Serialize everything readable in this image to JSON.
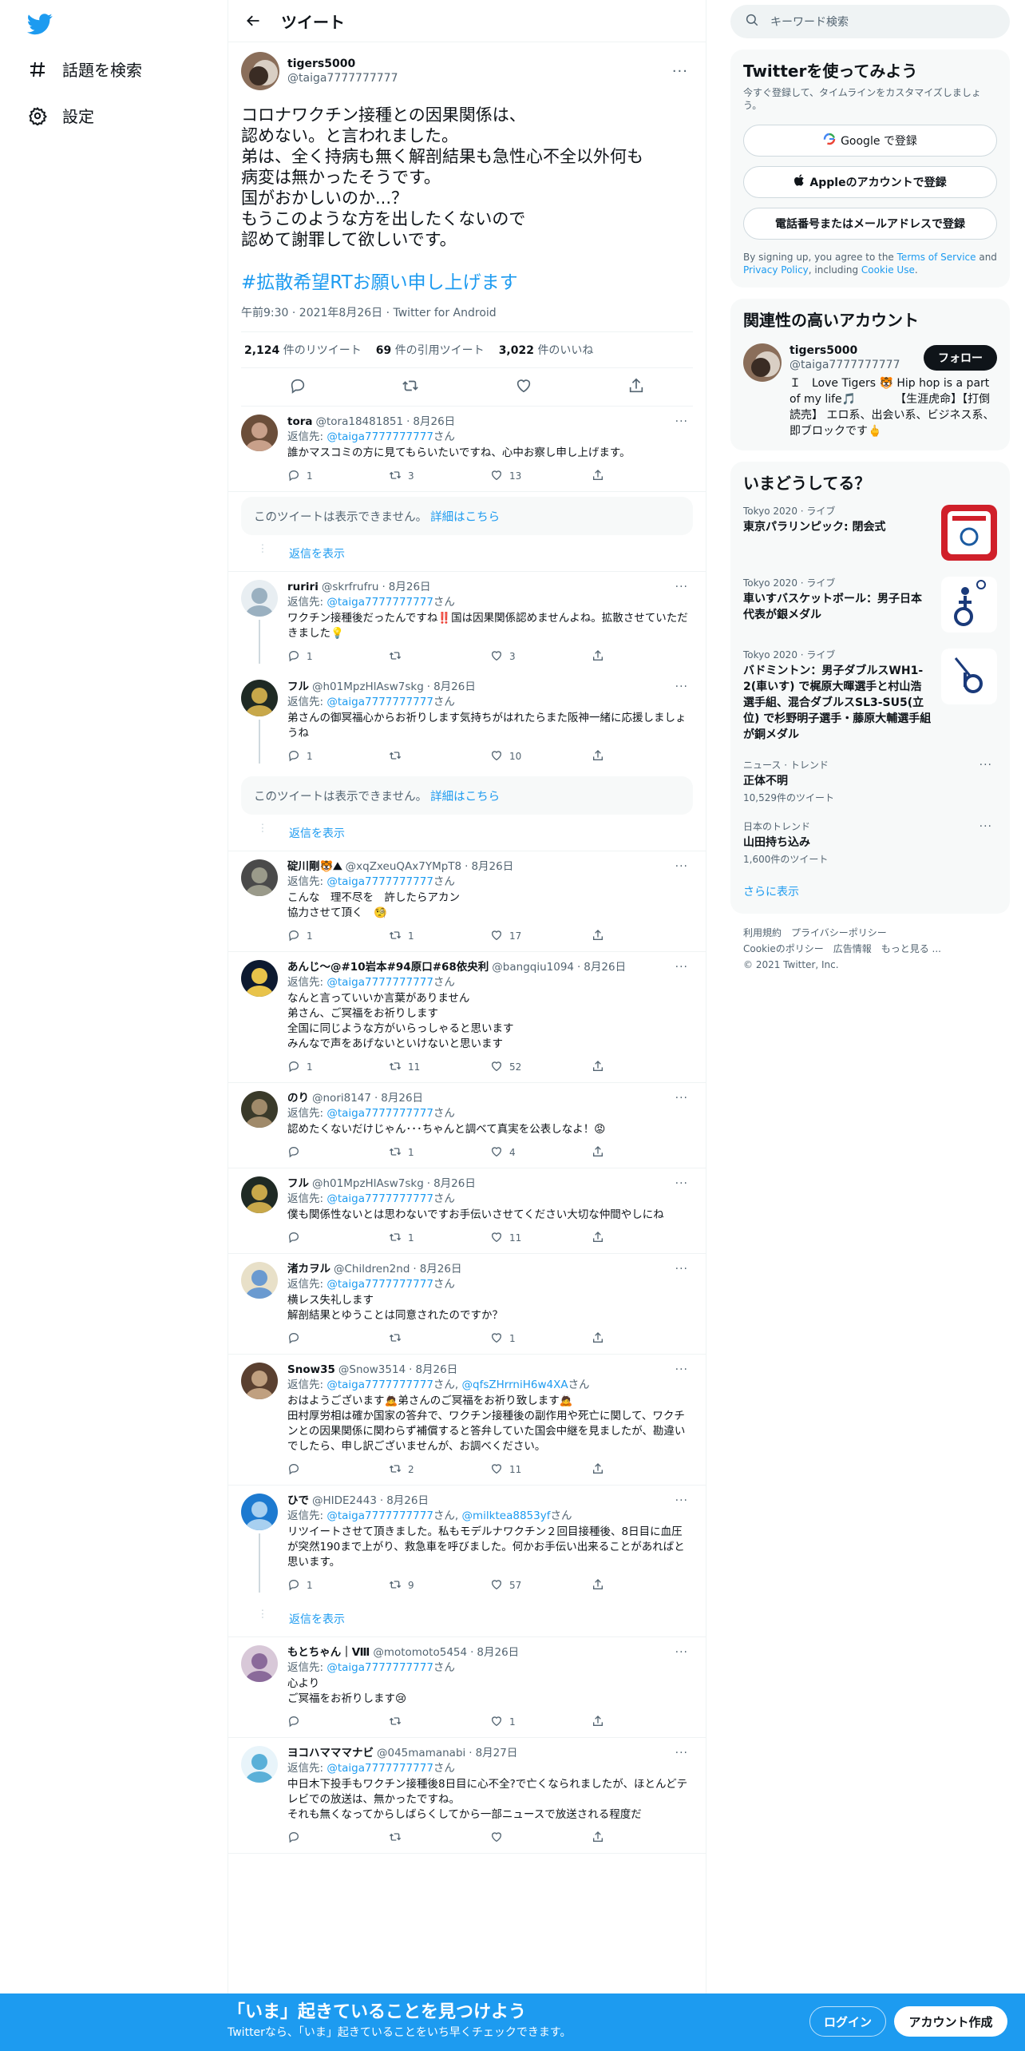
{
  "left_nav": {
    "explore_label": "話題を検索",
    "settings_label": "設定"
  },
  "header": {
    "title": "ツイート"
  },
  "focus_tweet": {
    "author_name": "tigers5000",
    "author_handle": "@taiga7777777777",
    "text": "コロナワクチン接種との因果関係は、\n認めない。と言われました。\n弟は、全く持病も無く解剖結果も急性心不全以外何も\n病変は無かったそうです。\n国がおかしいのか...？\nもうこのような方を出したくないので\n認めて謝罪して欲しいです。",
    "hashtag": "#拡散希望RTお願い申し上げます",
    "meta": "午前9:30 · 2021年8月26日 · Twitter for Android",
    "retweets": "2,124",
    "retweets_label": "件のリツイート",
    "quotes": "69",
    "quotes_label": "件の引用ツイート",
    "likes": "3,022",
    "likes_label": "件のいいね"
  },
  "reply_to_label": "返信先:",
  "san": "さん",
  "hidden_text": "このツイートは表示できません。",
  "hidden_link": "詳細はこちら",
  "show_replies": "返信を表示",
  "replies": [
    {
      "name": "tora",
      "handle": "@tora18481851",
      "date": "8月26日",
      "to": "@taiga7777777777",
      "text": "誰かマスコミの方に見てもらいたいですね、心中お察し申し上げます。",
      "reply": "1",
      "rt": "3",
      "like": "13"
    },
    {
      "name": "ruriri",
      "handle": "@skrfrufru",
      "date": "8月26日",
      "to": "@taiga7777777777",
      "text": "ワクチン接種後だったんですね‼️国は因果関係認めませんよね。拡散させていただきました💡",
      "reply": "1",
      "rt": "",
      "like": "3"
    },
    {
      "name": "フル",
      "handle": "@h01MpzHlAsw7skg",
      "date": "8月26日",
      "to": "@taiga7777777777",
      "text": "弟さんの御冥福心からお祈りします気持ちがはれたらまた阪神一緒に応援しましょうね",
      "reply": "1",
      "rt": "",
      "like": "10"
    },
    {
      "name": "碇川剛🐯⛰",
      "handle": "@xqZxeuQAx7YMpT8",
      "date": "8月26日",
      "to": "@taiga7777777777",
      "text": "こんな　理不尽を　許したらアカン\n協力させて頂く　🧐",
      "reply": "1",
      "rt": "1",
      "like": "17"
    },
    {
      "name": "あんじ〜@#10岩本#94原口#68依央利",
      "handle": "@bangqiu1094",
      "date": "8月26日",
      "to": "@taiga7777777777",
      "text": "なんと言っていいか言葉がありません\n弟さん、ご冥福をお祈りします\n全国に同じような方がいらっしゃると思います\nみんなで声をあげないといけないと思います",
      "reply": "1",
      "rt": "11",
      "like": "52"
    },
    {
      "name": "のり",
      "handle": "@nori8147",
      "date": "8月26日",
      "to": "@taiga7777777777",
      "text": "認めたくないだけじゃん･･･ちゃんと調べて真実を公表しなよ！😡",
      "reply": "",
      "rt": "1",
      "like": "4"
    },
    {
      "name": "フル",
      "handle": "@h01MpzHlAsw7skg",
      "date": "8月26日",
      "to": "@taiga7777777777",
      "text": "僕も関係性ないとは思わないですお手伝いさせてください大切な仲間やしにね",
      "reply": "",
      "rt": "1",
      "like": "11"
    },
    {
      "name": "渚カヲル",
      "handle": "@Children2nd",
      "date": "8月26日",
      "to": "@taiga7777777777",
      "text": "横レス失礼します\n解剖結果とゆうことは同意されたのですか？",
      "reply": "",
      "rt": "",
      "like": "1"
    },
    {
      "name": "Snow35",
      "handle": "@Snow3514",
      "date": "8月26日",
      "to": "@taiga7777777777",
      "to2": "@qfsZHrrniH6w4XA",
      "text": "おはようございます🙇弟さんのご冥福をお祈り致します🙇\n田村厚労相は確か国家の答弁で、ワクチン接種後の副作用や死亡に関して、ワクチンとの因果関係に関わらず補償すると答弁していた国会中継を見ましたが、勘違いでしたら、申し訳ございませんが、お調べください。",
      "reply": "",
      "rt": "2",
      "like": "11"
    },
    {
      "name": "ひで",
      "handle": "@HIDE2443",
      "date": "8月26日",
      "to": "@taiga7777777777",
      "to2": "@milktea8853yf",
      "text": "リツイートさせて頂きました。私もモデルナワクチン２回目接種後、8日目に血圧が突然190まで上がり、救急車を呼びました。何かお手伝い出来ることがあればと思います。",
      "reply": "1",
      "rt": "9",
      "like": "57"
    },
    {
      "name": "もとちゃん｜Ⅷ",
      "handle": "@motomoto5454",
      "date": "8月26日",
      "to": "@taiga7777777777",
      "text": "心より\nご冥福をお祈りします😢",
      "reply": "",
      "rt": "",
      "like": "1"
    },
    {
      "name": "ヨコハマママナビ",
      "handle": "@045mamanabi",
      "date": "8月27日",
      "to": "@taiga7777777777",
      "text": "中日木下投手もワクチン接種後8日目に心不全?で亡くなられましたが、ほとんどテレビでの放送は、無かったですね。\nそれも無くなってからしばらくしてから一部ニュースで放送される程度だ",
      "reply": "",
      "rt": "",
      "like": ""
    }
  ],
  "sidebar": {
    "search_placeholder": "キーワード検索",
    "signup_title": "Twitterを使ってみよう",
    "signup_sub": "今すぐ登録して、タイムラインをカスタマイズしましょう。",
    "google_btn": "Google で登録",
    "apple_btn": "Appleのアカウントで登録",
    "phone_btn": "電話番号またはメールアドレスで登録",
    "legal_1": "By signing up, you agree to the ",
    "legal_tos": "Terms of Service",
    "legal_2": " and ",
    "legal_privacy": "Privacy Policy",
    "legal_3": ", including ",
    "legal_cookie": "Cookie Use",
    "legal_4": ".",
    "related_title": "関連性の高いアカウント",
    "acct_name": "tigers5000",
    "acct_handle": "@taiga7777777777",
    "acct_follow": "フォロー",
    "acct_bio": "Ｉ　Love Tigers 🐯 Hip hop is a part of my life🎵　　　　【生涯虎命】【打倒読売】 エロ系、出会い系、ビジネス系、即ブロックです🖕",
    "trends_title": "いまどうしてる？",
    "trends": [
      {
        "cat": "Tokyo 2020 · ライブ",
        "title": "東京パラリンピック: 閉会式",
        "count": ""
      },
      {
        "cat": "Tokyo 2020 · ライブ",
        "title": "車いすバスケットボール：男子日本代表が銀メダル",
        "count": ""
      },
      {
        "cat": "Tokyo 2020 · ライブ",
        "title": "バドミントン：男子ダブルスWH1-2(車いす) で梶原大暉選手と村山浩選手組、混合ダブルスSL3-SU5(立位) で杉野明子選手・藤原大輔選手組が銅メダル",
        "count": ""
      },
      {
        "cat": "ニュース · トレンド",
        "title": "正体不明",
        "count": "10,529件のツイート"
      },
      {
        "cat": "日本のトレンド",
        "title": "山田持ち込み",
        "count": "1,600件のツイート"
      }
    ],
    "show_more": "さらに表示",
    "footer_1": "利用規約　プライバシーポリシー",
    "footer_2": "Cookieのポリシー　広告情報　もっと見る ...",
    "footer_3": "© 2021 Twitter, Inc."
  },
  "bottom_bar": {
    "title": "「いま」起きていることを見つけよう",
    "sub": "Twitterなら、「いま」起きていることをいち早くチェックできます。",
    "login": "ログイン",
    "signup": "アカウント作成"
  },
  "colors": {
    "accent": "#1d9bf0",
    "text": "#0f1419",
    "muted": "#536471"
  }
}
